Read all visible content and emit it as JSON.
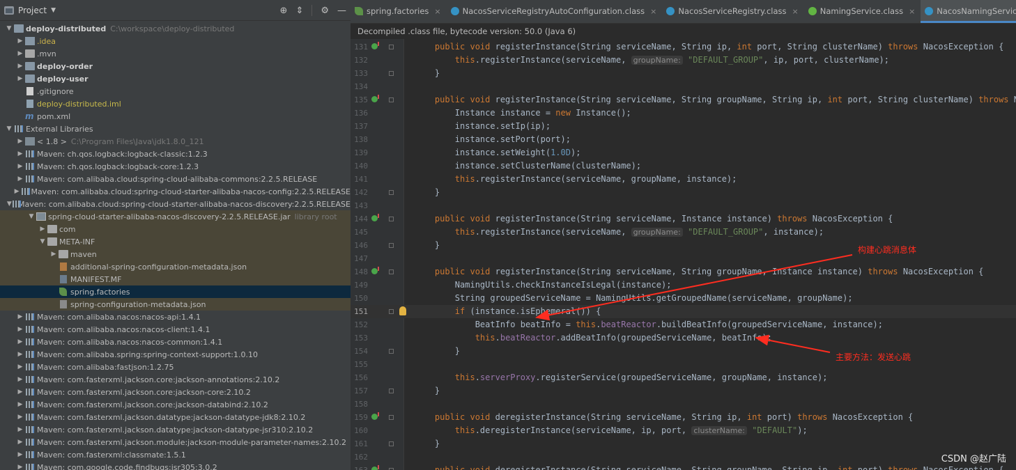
{
  "project_panel": {
    "title": "Project",
    "tree": [
      {
        "label": "deploy-distributed",
        "path": "C:\\workspace\\deploy-distributed",
        "indent": 0,
        "arrow": "down",
        "icon": "folder-module",
        "style": "bold"
      },
      {
        "label": ".idea",
        "indent": 1,
        "arrow": "right",
        "icon": "folder-idea",
        "style": "idea"
      },
      {
        "label": ".mvn",
        "indent": 1,
        "arrow": "right",
        "icon": "folder",
        "style": ""
      },
      {
        "label": "deploy-order",
        "indent": 1,
        "arrow": "right",
        "icon": "folder-module",
        "style": "bold"
      },
      {
        "label": "deploy-user",
        "indent": 1,
        "arrow": "right",
        "icon": "folder-module",
        "style": "bold"
      },
      {
        "label": ".gitignore",
        "indent": 1,
        "arrow": "",
        "icon": "file",
        "style": ""
      },
      {
        "label": "deploy-distributed.iml",
        "indent": 1,
        "arrow": "",
        "icon": "iml",
        "style": "iml"
      },
      {
        "label": "pom.xml",
        "indent": 1,
        "arrow": "",
        "icon": "maven-m",
        "style": ""
      },
      {
        "label": "External Libraries",
        "indent": 0,
        "arrow": "down",
        "icon": "lib",
        "style": ""
      },
      {
        "label": "< 1.8 >",
        "path": "C:\\Program Files\\Java\\jdk1.8.0_121",
        "indent": 1,
        "arrow": "right",
        "icon": "jdk",
        "style": ""
      },
      {
        "label": "Maven: ch.qos.logback:logback-classic:1.2.3",
        "indent": 1,
        "arrow": "right",
        "icon": "lib",
        "style": ""
      },
      {
        "label": "Maven: ch.qos.logback:logback-core:1.2.3",
        "indent": 1,
        "arrow": "right",
        "icon": "lib",
        "style": ""
      },
      {
        "label": "Maven: com.alibaba.cloud:spring-cloud-alibaba-commons:2.2.5.RELEASE",
        "indent": 1,
        "arrow": "right",
        "icon": "lib",
        "style": ""
      },
      {
        "label": "Maven: com.alibaba.cloud:spring-cloud-starter-alibaba-nacos-config:2.2.5.RELEASE",
        "indent": 1,
        "arrow": "right",
        "icon": "lib",
        "style": ""
      },
      {
        "label": "Maven: com.alibaba.cloud:spring-cloud-starter-alibaba-nacos-discovery:2.2.5.RELEASE",
        "indent": 1,
        "arrow": "down",
        "icon": "lib",
        "style": ""
      },
      {
        "label": "spring-cloud-starter-alibaba-nacos-discovery-2.2.5.RELEASE.jar",
        "path": "library root",
        "indent": 2,
        "arrow": "down",
        "icon": "jar",
        "style": "",
        "row": "hl"
      },
      {
        "label": "com",
        "indent": 3,
        "arrow": "right",
        "icon": "folder",
        "style": "",
        "row": "hl"
      },
      {
        "label": "META-INF",
        "indent": 3,
        "arrow": "down",
        "icon": "folder",
        "style": "",
        "row": "hl"
      },
      {
        "label": "maven",
        "indent": 4,
        "arrow": "right",
        "icon": "folder",
        "style": "",
        "row": "hl"
      },
      {
        "label": "additional-spring-configuration-metadata.json",
        "indent": 4,
        "arrow": "",
        "icon": "json",
        "style": "",
        "row": "hl"
      },
      {
        "label": "MANIFEST.MF",
        "indent": 4,
        "arrow": "",
        "icon": "mf",
        "style": "",
        "row": "hl"
      },
      {
        "label": "spring.factories",
        "indent": 4,
        "arrow": "",
        "icon": "leaf",
        "style": "",
        "row": "sel"
      },
      {
        "label": "spring-configuration-metadata.json",
        "indent": 4,
        "arrow": "",
        "icon": "json2",
        "style": "",
        "row": "hl"
      },
      {
        "label": "Maven: com.alibaba.nacos:nacos-api:1.4.1",
        "indent": 1,
        "arrow": "right",
        "icon": "lib",
        "style": ""
      },
      {
        "label": "Maven: com.alibaba.nacos:nacos-client:1.4.1",
        "indent": 1,
        "arrow": "right",
        "icon": "lib",
        "style": ""
      },
      {
        "label": "Maven: com.alibaba.nacos:nacos-common:1.4.1",
        "indent": 1,
        "arrow": "right",
        "icon": "lib",
        "style": ""
      },
      {
        "label": "Maven: com.alibaba.spring:spring-context-support:1.0.10",
        "indent": 1,
        "arrow": "right",
        "icon": "lib",
        "style": ""
      },
      {
        "label": "Maven: com.alibaba:fastjson:1.2.75",
        "indent": 1,
        "arrow": "right",
        "icon": "lib",
        "style": ""
      },
      {
        "label": "Maven: com.fasterxml.jackson.core:jackson-annotations:2.10.2",
        "indent": 1,
        "arrow": "right",
        "icon": "lib",
        "style": ""
      },
      {
        "label": "Maven: com.fasterxml.jackson.core:jackson-core:2.10.2",
        "indent": 1,
        "arrow": "right",
        "icon": "lib",
        "style": ""
      },
      {
        "label": "Maven: com.fasterxml.jackson.core:jackson-databind:2.10.2",
        "indent": 1,
        "arrow": "right",
        "icon": "lib",
        "style": ""
      },
      {
        "label": "Maven: com.fasterxml.jackson.datatype:jackson-datatype-jdk8:2.10.2",
        "indent": 1,
        "arrow": "right",
        "icon": "lib",
        "style": ""
      },
      {
        "label": "Maven: com.fasterxml.jackson.datatype:jackson-datatype-jsr310:2.10.2",
        "indent": 1,
        "arrow": "right",
        "icon": "lib",
        "style": ""
      },
      {
        "label": "Maven: com.fasterxml.jackson.module:jackson-module-parameter-names:2.10.2",
        "indent": 1,
        "arrow": "right",
        "icon": "lib",
        "style": ""
      },
      {
        "label": "Maven: com.fasterxml:classmate:1.5.1",
        "indent": 1,
        "arrow": "right",
        "icon": "lib",
        "style": ""
      },
      {
        "label": "Maven: com.google.code.findbugs:jsr305:3.0.2",
        "indent": 1,
        "arrow": "right",
        "icon": "lib",
        "style": ""
      }
    ]
  },
  "editor": {
    "tabs": [
      {
        "label": "spring.factories",
        "icon": "leaf",
        "active": false
      },
      {
        "label": "NacosServiceRegistryAutoConfiguration.class",
        "icon": "cls",
        "active": false
      },
      {
        "label": "NacosServiceRegistry.class",
        "icon": "cls",
        "active": false
      },
      {
        "label": "NamingService.class",
        "icon": "intf",
        "active": false
      },
      {
        "label": "NacosNamingService.class",
        "icon": "cls",
        "active": true
      }
    ],
    "info_bar": "Decompiled .class file, bytecode version: 50.0 (Java 6)",
    "lines": [
      {
        "n": "131",
        "mark": true,
        "fold": true,
        "tokens": [
          [
            "    ",
            ""
          ],
          [
            "public void ",
            "kw"
          ],
          [
            "registerInstance(String serviceName, String ip, ",
            ""
          ],
          [
            "int ",
            "kw"
          ],
          [
            "port, String clusterName) ",
            ""
          ],
          [
            "throws ",
            "kw"
          ],
          [
            "NacosException {",
            ""
          ]
        ]
      },
      {
        "n": "132",
        "tokens": [
          [
            "        ",
            ""
          ],
          [
            "this",
            "kw"
          ],
          [
            ".registerInstance(serviceName, ",
            ""
          ],
          [
            "groupName:",
            "hint"
          ],
          [
            " ",
            ""
          ],
          [
            "\"DEFAULT_GROUP\"",
            "str"
          ],
          [
            ", ip, port, clusterName);",
            ""
          ]
        ]
      },
      {
        "n": "133",
        "fold": true,
        "tokens": [
          [
            "    }",
            ""
          ]
        ]
      },
      {
        "n": "134",
        "tokens": []
      },
      {
        "n": "135",
        "mark": true,
        "fold": true,
        "tokens": [
          [
            "    ",
            ""
          ],
          [
            "public void ",
            "kw"
          ],
          [
            "registerInstance(String serviceName, String groupName, String ip, ",
            ""
          ],
          [
            "int ",
            "kw"
          ],
          [
            "port, String clusterName) ",
            ""
          ],
          [
            "throws ",
            "kw"
          ],
          [
            "NacosException {",
            ""
          ]
        ]
      },
      {
        "n": "136",
        "tokens": [
          [
            "        Instance instance = ",
            ""
          ],
          [
            "new ",
            "kw"
          ],
          [
            "Instance();",
            ""
          ]
        ]
      },
      {
        "n": "137",
        "tokens": [
          [
            "        instance.setIp(ip);",
            ""
          ]
        ]
      },
      {
        "n": "138",
        "tokens": [
          [
            "        instance.setPort(port);",
            ""
          ]
        ]
      },
      {
        "n": "139",
        "tokens": [
          [
            "        instance.setWeight(",
            ""
          ],
          [
            "1.0D",
            "num"
          ],
          [
            ");",
            ""
          ]
        ]
      },
      {
        "n": "140",
        "tokens": [
          [
            "        instance.setClusterName(clusterName);",
            ""
          ]
        ]
      },
      {
        "n": "141",
        "tokens": [
          [
            "        ",
            ""
          ],
          [
            "this",
            "kw"
          ],
          [
            ".registerInstance(serviceName, groupName, instance);",
            ""
          ]
        ]
      },
      {
        "n": "142",
        "fold": true,
        "tokens": [
          [
            "    }",
            ""
          ]
        ]
      },
      {
        "n": "143",
        "tokens": []
      },
      {
        "n": "144",
        "mark": true,
        "fold": true,
        "tokens": [
          [
            "    ",
            ""
          ],
          [
            "public void ",
            "kw"
          ],
          [
            "registerInstance(String serviceName, Instance instance) ",
            ""
          ],
          [
            "throws ",
            "kw"
          ],
          [
            "NacosException {",
            ""
          ]
        ]
      },
      {
        "n": "145",
        "tokens": [
          [
            "        ",
            ""
          ],
          [
            "this",
            "kw"
          ],
          [
            ".registerInstance(serviceName, ",
            ""
          ],
          [
            "groupName:",
            "hint"
          ],
          [
            " ",
            ""
          ],
          [
            "\"DEFAULT_GROUP\"",
            "str"
          ],
          [
            ", instance);",
            ""
          ]
        ]
      },
      {
        "n": "146",
        "fold": true,
        "tokens": [
          [
            "    }",
            ""
          ]
        ]
      },
      {
        "n": "147",
        "tokens": []
      },
      {
        "n": "148",
        "mark": true,
        "fold": true,
        "tokens": [
          [
            "    ",
            ""
          ],
          [
            "public void ",
            "kw"
          ],
          [
            "registerInstance(String serviceName, String groupName, Instance instance) ",
            ""
          ],
          [
            "throws ",
            "kw"
          ],
          [
            "NacosException {",
            ""
          ]
        ]
      },
      {
        "n": "149",
        "tokens": [
          [
            "        NamingUtils.checkInstanceIsLegal(instance);",
            ""
          ]
        ]
      },
      {
        "n": "150",
        "tokens": [
          [
            "        String groupedServiceName = NamingUtils.getGroupedName(serviceName, groupName);",
            ""
          ]
        ]
      },
      {
        "n": "151",
        "current": true,
        "bulb": true,
        "fold": true,
        "tokens": [
          [
            "        ",
            ""
          ],
          [
            "if ",
            "kw"
          ],
          [
            "(instance.isEphemeral()) {",
            ""
          ]
        ]
      },
      {
        "n": "152",
        "tokens": [
          [
            "            BeatInfo beatInfo = ",
            ""
          ],
          [
            "this",
            "kw"
          ],
          [
            ".",
            ""
          ],
          [
            "beatReactor",
            "fld"
          ],
          [
            ".buildBeatInfo(groupedServiceName, instance);",
            ""
          ]
        ]
      },
      {
        "n": "153",
        "tokens": [
          [
            "            ",
            ""
          ],
          [
            "this",
            "kw"
          ],
          [
            ".",
            ""
          ],
          [
            "beatReactor",
            "fld"
          ],
          [
            ".addBeatInfo(groupedServiceName, beatInfo);",
            ""
          ]
        ]
      },
      {
        "n": "154",
        "fold": true,
        "tokens": [
          [
            "        }",
            ""
          ]
        ]
      },
      {
        "n": "155",
        "tokens": []
      },
      {
        "n": "156",
        "tokens": [
          [
            "        ",
            ""
          ],
          [
            "this",
            "kw"
          ],
          [
            ".",
            ""
          ],
          [
            "serverProxy",
            "fld"
          ],
          [
            ".registerService(groupedServiceName, groupName, instance);",
            ""
          ]
        ]
      },
      {
        "n": "157",
        "fold": true,
        "tokens": [
          [
            "    }",
            ""
          ]
        ]
      },
      {
        "n": "158",
        "tokens": []
      },
      {
        "n": "159",
        "mark": true,
        "fold": true,
        "tokens": [
          [
            "    ",
            ""
          ],
          [
            "public void ",
            "kw"
          ],
          [
            "deregisterInstance(String serviceName, String ip, ",
            ""
          ],
          [
            "int ",
            "kw"
          ],
          [
            "port) ",
            ""
          ],
          [
            "throws ",
            "kw"
          ],
          [
            "NacosException {",
            ""
          ]
        ]
      },
      {
        "n": "160",
        "tokens": [
          [
            "        ",
            ""
          ],
          [
            "this",
            "kw"
          ],
          [
            ".deregisterInstance(serviceName, ip, port, ",
            ""
          ],
          [
            "clusterName:",
            "hint"
          ],
          [
            " ",
            ""
          ],
          [
            "\"DEFAULT\"",
            "str"
          ],
          [
            ");",
            ""
          ]
        ]
      },
      {
        "n": "161",
        "fold": true,
        "tokens": [
          [
            "    }",
            ""
          ]
        ]
      },
      {
        "n": "162",
        "tokens": []
      },
      {
        "n": "163",
        "mark": true,
        "fold": true,
        "tokens": [
          [
            "    ",
            ""
          ],
          [
            "public void ",
            "kw"
          ],
          [
            "deregisterInstance(String serviceName, String groupName, String ip, ",
            ""
          ],
          [
            "int ",
            "kw"
          ],
          [
            "port) ",
            ""
          ],
          [
            "throws ",
            "kw"
          ],
          [
            "NacosException {",
            ""
          ]
        ]
      }
    ]
  },
  "annotations": {
    "build_heartbeat": "构建心跳消息体",
    "main_method": "主要方法：发送心跳",
    "color": "#ff2d20"
  },
  "watermark": "CSDN @赵广陆",
  "colors": {
    "keyword": "#cc7832",
    "string": "#6a8759",
    "number": "#6897bb",
    "field": "#9876aa",
    "plain": "#a9b7c6",
    "accent": "#4a88c7"
  }
}
